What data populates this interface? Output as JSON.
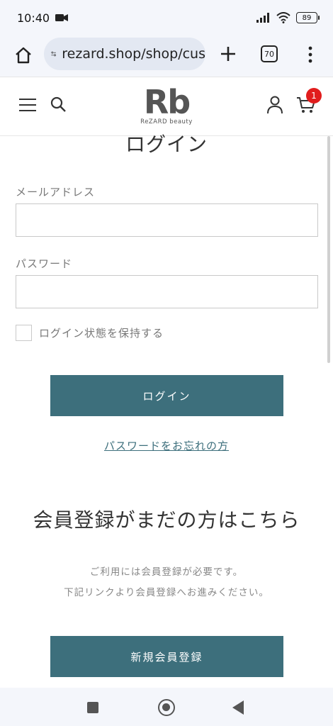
{
  "status": {
    "time": "10:40",
    "battery": "89"
  },
  "browser": {
    "url": "rezard.shop/shop/cus",
    "tab_count": "70"
  },
  "site": {
    "logo_mark": "Rb",
    "logo_sub": "ReZARD beauty",
    "cart_count": "1"
  },
  "login": {
    "title": "ログイン",
    "email_label": "メールアドレス",
    "email_value": "",
    "password_label": "パスワード",
    "password_value": "",
    "remember_label": "ログイン状態を保持する",
    "submit_label": "ログイン",
    "forgot_label": "パスワードをお忘れの方"
  },
  "register": {
    "title": "会員登録がまだの方はこちら",
    "desc_line1": "ご利用には会員登録が必要です。",
    "desc_line2": "下記リンクより会員登録へお進みください。",
    "button_label": "新規会員登録"
  },
  "icons": {
    "video": "video-camera-icon",
    "signal": "signal-icon",
    "wifi": "wifi-icon",
    "home": "home-icon",
    "site_settings": "site-settings-icon",
    "plus": "plus-icon",
    "more": "more-vertical-icon",
    "menu": "hamburger-menu-icon",
    "search": "search-icon",
    "account": "account-icon",
    "cart": "cart-icon"
  },
  "colors": {
    "accent": "#3d6f7c",
    "badge": "#e11d1d"
  }
}
